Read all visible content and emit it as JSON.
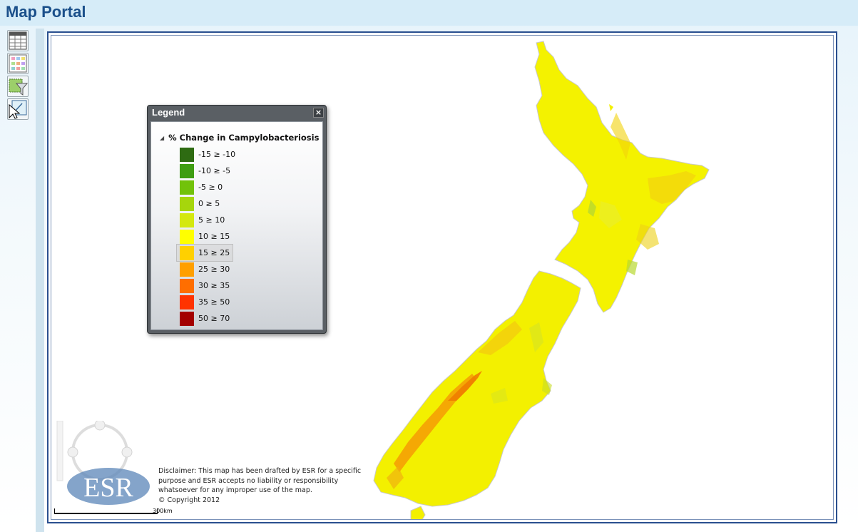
{
  "app": {
    "title": "Map Portal"
  },
  "toolbar": {
    "buttons": [
      {
        "name": "table-view-button",
        "icon": "table-icon"
      },
      {
        "name": "grid-view-button",
        "icon": "grid-icon"
      },
      {
        "name": "filter-button",
        "icon": "filter-icon"
      },
      {
        "name": "select-button",
        "icon": "cursor-select-icon"
      }
    ]
  },
  "legend": {
    "title": "Legend",
    "close_label": "×",
    "layer_name": "% Change in Campylobacteriosis",
    "selected_index": 6,
    "items": [
      {
        "label": "-15 ≥ -10",
        "color": "#2e6b12"
      },
      {
        "label": "-10 ≥ -5",
        "color": "#3f9e12"
      },
      {
        "label": "-5 ≥ 0",
        "color": "#72c20a"
      },
      {
        "label": "0 ≥ 5",
        "color": "#a6d60c"
      },
      {
        "label": "5 ≥ 10",
        "color": "#d4e80e"
      },
      {
        "label": "10 ≥ 15",
        "color": "#ffff00"
      },
      {
        "label": "15 ≥ 25",
        "color": "#ffd000"
      },
      {
        "label": "25 ≥ 30",
        "color": "#ff9f00"
      },
      {
        "label": "30 ≥ 35",
        "color": "#ff6e00"
      },
      {
        "label": "35 ≥ 50",
        "color": "#ff3300"
      },
      {
        "label": "50 ≥ 70",
        "color": "#a30000"
      }
    ]
  },
  "map": {
    "disclaimer_lines": [
      "Disclaimer: This map has been drafted by ESR for a specific",
      "purpose and ESR accepts no liability or responsibility",
      "whatsoever for any improper use of the map.",
      "© Copyright 2012"
    ],
    "scale_label": "300km",
    "logo_text": "ESR"
  }
}
